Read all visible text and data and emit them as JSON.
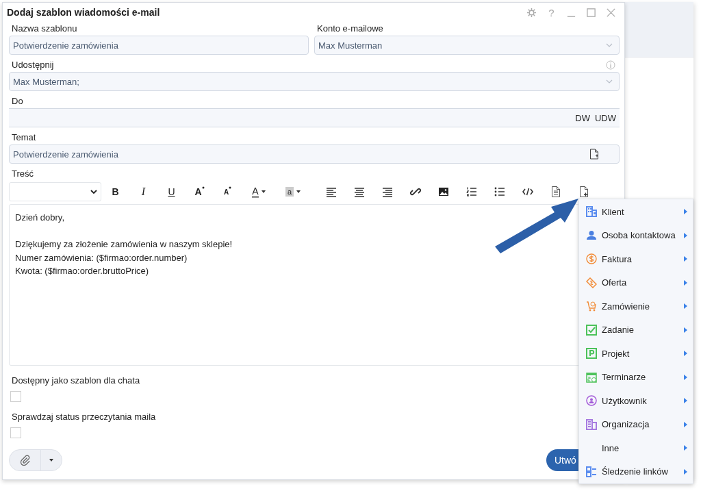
{
  "window": {
    "title": "Dodaj szablon wiadomości e-mail",
    "help_glyph": "?"
  },
  "template_name": {
    "label": "Nazwa szablonu",
    "value": "Potwierdzenie zamówienia"
  },
  "email_account": {
    "label": "Konto e-mailowe",
    "value": "Max Musterman"
  },
  "share": {
    "label": "Udostępnij",
    "value": "Max Musterman;"
  },
  "to": {
    "label": "Do",
    "cc": "DW",
    "bcc": "UDW"
  },
  "subject": {
    "label": "Temat",
    "value": "Potwierdzenie zamówienia"
  },
  "body": {
    "label": "Treść",
    "toolbar": [
      {
        "kind": "bold",
        "glyph": "B"
      },
      {
        "kind": "italic",
        "glyph": "I"
      },
      {
        "kind": "underline",
        "glyph": "U"
      },
      {
        "kind": "grow",
        "glyph": "A"
      },
      {
        "kind": "shrink",
        "glyph": "A"
      },
      {
        "kind": "color",
        "glyph": "A"
      },
      {
        "kind": "highlight",
        "glyph": "a"
      },
      {
        "kind": "align-left"
      },
      {
        "kind": "align-center"
      },
      {
        "kind": "align-right"
      },
      {
        "kind": "link"
      },
      {
        "kind": "image"
      },
      {
        "kind": "ordered-list"
      },
      {
        "kind": "bullet-list"
      },
      {
        "kind": "code"
      },
      {
        "kind": "document"
      },
      {
        "kind": "insert-field"
      }
    ],
    "paragraphs": [
      [
        "Dzień dobry,"
      ],
      [
        "Dziękujemy za złożenie zamówienia w naszym sklepie!",
        "Numer zamówienia: ($firmao:order.number)",
        "Kwota: ($firmao:order.bruttoPrice)"
      ]
    ]
  },
  "checkboxes": [
    {
      "label": "Dostępny jako szablon dla chata",
      "checked": false
    },
    {
      "label": "Sprawdzaj status przeczytania maila",
      "checked": false
    }
  ],
  "create_button": {
    "label": "Utwó"
  },
  "insert_menu": {
    "items": [
      {
        "label": "Klient",
        "kind": "building",
        "color": "#5b8def"
      },
      {
        "label": "Osoba kontaktowa",
        "kind": "person",
        "color": "#4a7fe0"
      },
      {
        "label": "Faktura",
        "kind": "invoice",
        "color": "#f28c38"
      },
      {
        "label": "Oferta",
        "kind": "offer",
        "color": "#f28c38"
      },
      {
        "label": "Zamówienie",
        "kind": "order",
        "color": "#f28c38"
      },
      {
        "label": "Zadanie",
        "kind": "task",
        "color": "#4cc25a"
      },
      {
        "label": "Projekt",
        "kind": "project",
        "color": "#4cc25a"
      },
      {
        "label": "Terminarze",
        "kind": "calendar",
        "color": "#4cc25a"
      },
      {
        "label": "Użytkownik",
        "kind": "user",
        "color": "#a35ad8"
      },
      {
        "label": "Organizacja",
        "kind": "organization",
        "color": "#a77be0"
      },
      {
        "label": "Inne",
        "kind": "none"
      },
      {
        "label": "Śledzenie linków",
        "kind": "links",
        "color": "#5b8def"
      }
    ]
  }
}
